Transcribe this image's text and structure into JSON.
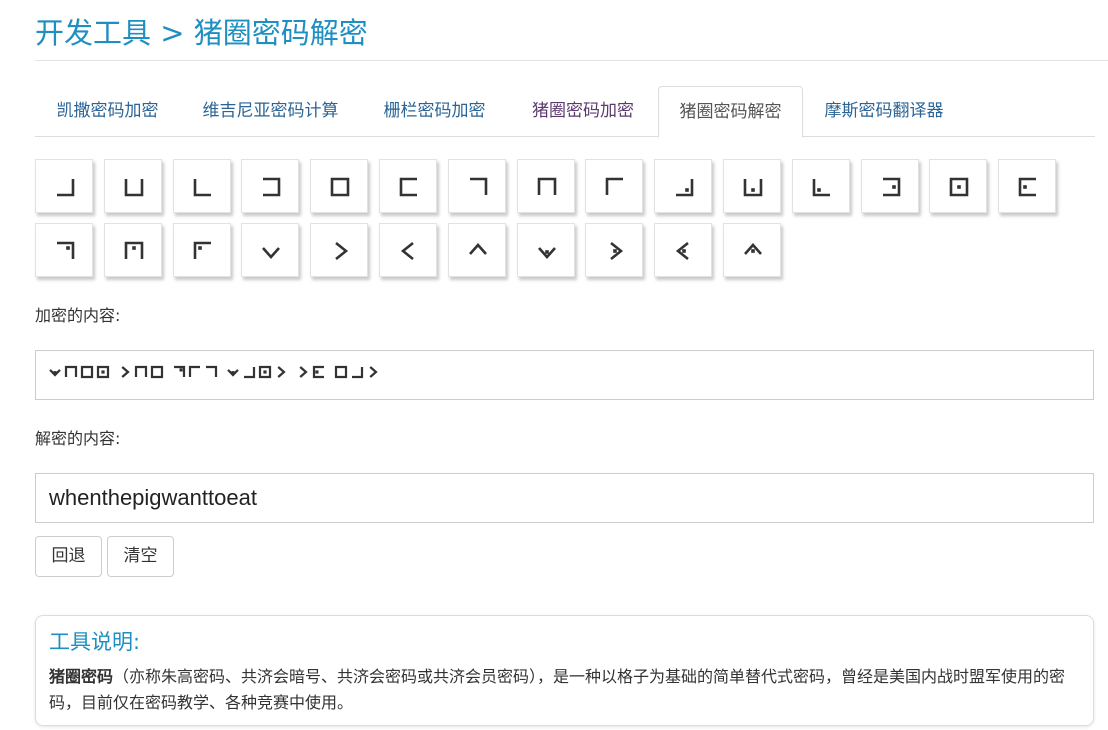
{
  "breadcrumb": {
    "parent": "开发工具",
    "separator": ">",
    "current": "猪圈密码解密"
  },
  "tabs": [
    {
      "label": "凯撒密码加密",
      "state": "normal"
    },
    {
      "label": "维吉尼亚密码计算",
      "state": "normal"
    },
    {
      "label": "栅栏密码加密",
      "state": "normal"
    },
    {
      "label": "猪圈密码加密",
      "state": "visited"
    },
    {
      "label": "猪圈密码解密",
      "state": "active"
    },
    {
      "label": "摩斯密码翻译器",
      "state": "normal"
    }
  ],
  "symbol_keys": [
    {
      "icon": "grid-bottom-right-icon",
      "dot": false
    },
    {
      "icon": "grid-bottom-middle-icon",
      "dot": false
    },
    {
      "icon": "grid-bottom-left-icon",
      "dot": false
    },
    {
      "icon": "grid-middle-right-icon",
      "dot": false
    },
    {
      "icon": "grid-center-icon",
      "dot": false
    },
    {
      "icon": "grid-middle-left-icon",
      "dot": false
    },
    {
      "icon": "grid-top-right-icon",
      "dot": false
    },
    {
      "icon": "grid-top-middle-icon",
      "dot": false
    },
    {
      "icon": "grid-top-left-icon",
      "dot": false
    },
    {
      "icon": "grid-bottom-right-dot-icon",
      "dot": true
    },
    {
      "icon": "grid-bottom-middle-dot-icon",
      "dot": true
    },
    {
      "icon": "grid-bottom-left-dot-icon",
      "dot": true
    },
    {
      "icon": "grid-middle-right-dot-icon",
      "dot": true
    },
    {
      "icon": "grid-center-dot-icon",
      "dot": true
    },
    {
      "icon": "grid-middle-left-dot-icon",
      "dot": true
    },
    {
      "icon": "grid-top-right-dot-icon",
      "dot": true
    },
    {
      "icon": "grid-top-middle-dot-icon",
      "dot": true
    },
    {
      "icon": "grid-top-left-dot-icon",
      "dot": true
    },
    {
      "icon": "x-bottom-icon",
      "dot": false
    },
    {
      "icon": "x-right-icon",
      "dot": false
    },
    {
      "icon": "x-left-icon",
      "dot": false
    },
    {
      "icon": "x-top-icon",
      "dot": false
    },
    {
      "icon": "x-bottom-dot-icon",
      "dot": true
    },
    {
      "icon": "x-right-dot-icon",
      "dot": true
    },
    {
      "icon": "x-left-dot-icon",
      "dot": true
    },
    {
      "icon": "x-top-dot-icon",
      "dot": true
    }
  ],
  "encrypted": {
    "label": "加密的内容:",
    "value_letters": "when the pig want to eat"
  },
  "decrypted": {
    "label": "解密的内容:",
    "value": "whenthepigwanttoeat"
  },
  "buttons": {
    "back": "回退",
    "clear": "清空"
  },
  "info": {
    "title": "工具说明:",
    "term": "猪圈密码",
    "body": "（亦称朱高密码、共济会暗号、共济会密码或共济会员密码），是一种以格子为基础的简单替代式密码，曾经是美国内战时盟军使用的密码，目前仅在密码教学、各种竞赛中使用。"
  },
  "colors": {
    "title": "#1f8fc1",
    "link": "#2a6496",
    "visited": "#5b3a6e",
    "symbol": "#333333"
  }
}
